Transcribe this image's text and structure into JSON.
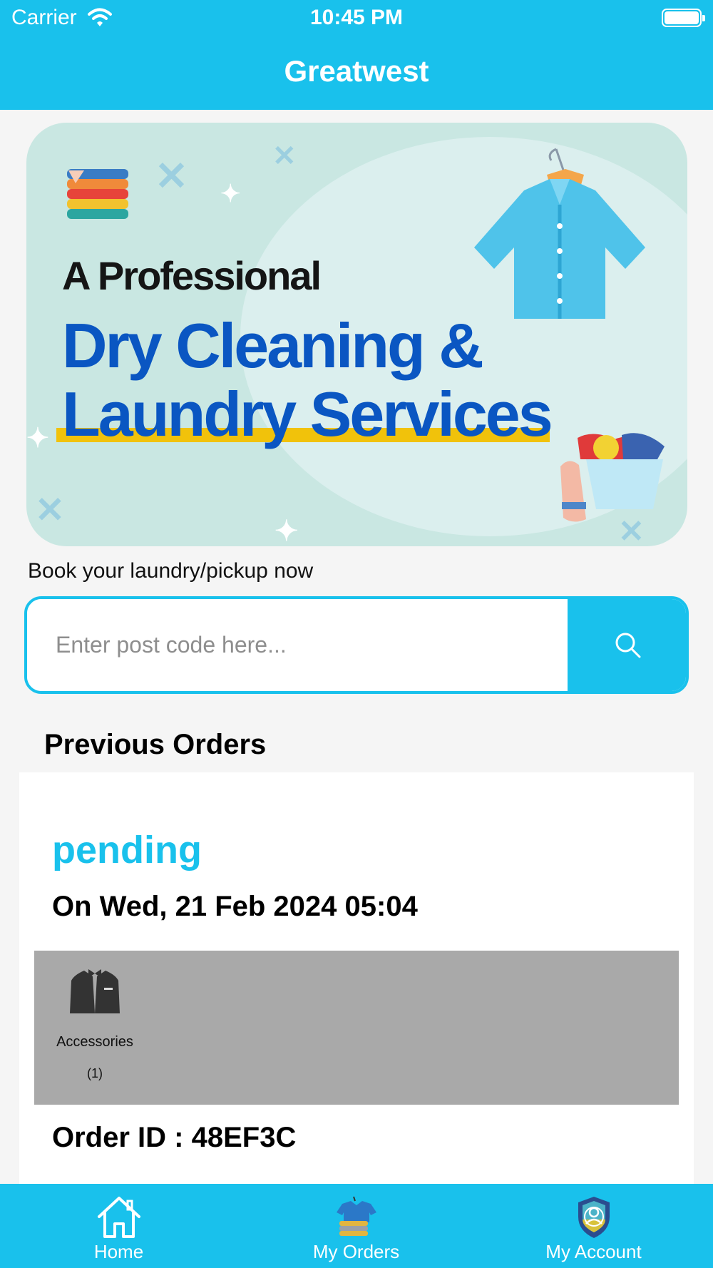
{
  "status_bar": {
    "carrier": "Carrier",
    "time": "10:45 PM"
  },
  "nav": {
    "title": "Greatwest"
  },
  "banner": {
    "line_small": "A Professional",
    "line_1": "Dry Cleaning &",
    "line_2": "Laundry Services"
  },
  "booking": {
    "label": "Book your laundry/pickup now",
    "search_placeholder": "Enter post code here...",
    "search_value": ""
  },
  "previous_orders": {
    "title": "Previous Orders",
    "orders": [
      {
        "status": "pending",
        "date": "On Wed, 21 Feb 2024 05:04",
        "items": [
          {
            "icon": "tuxedo-icon",
            "name": "Accessories",
            "qty": "(1)"
          }
        ],
        "order_id": "Order ID : 48EF3C"
      }
    ]
  },
  "tabs": [
    {
      "label": "Home",
      "icon": "home-icon"
    },
    {
      "label": "My Orders",
      "icon": "laundry-orders-icon"
    },
    {
      "label": "My Account",
      "icon": "account-shield-icon"
    }
  ],
  "colors": {
    "accent": "#19c1ec",
    "banner_blue": "#0a56c2",
    "banner_bg": "#c9e7e2",
    "highlight_yellow": "#f1c20b",
    "items_strip": "#a9a9a9",
    "page_bg": "#f5f5f5"
  }
}
